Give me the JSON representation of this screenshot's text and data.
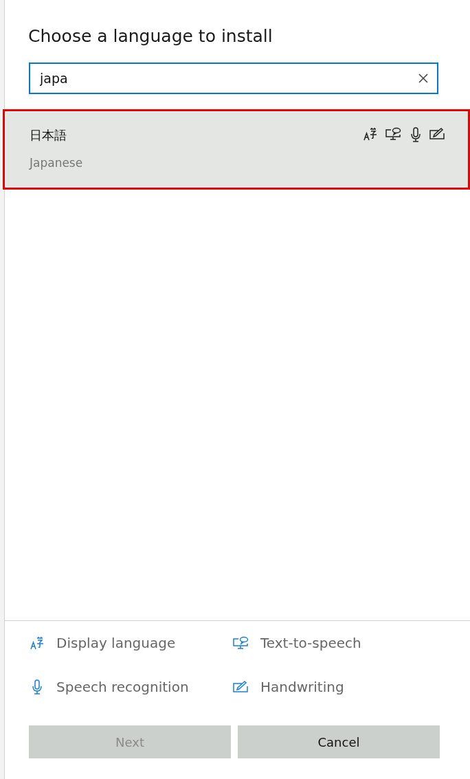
{
  "dialog": {
    "title": "Choose a language to install",
    "search": {
      "value": "japa"
    },
    "results": [
      {
        "native_name": "日本語",
        "name": "Japanese",
        "selected": true,
        "highlighted": true,
        "features": [
          {
            "kind": "display"
          },
          {
            "kind": "tts"
          },
          {
            "kind": "speech"
          },
          {
            "kind": "handwriting"
          }
        ]
      }
    ],
    "legend": [
      {
        "kind": "display",
        "label": "Display language"
      },
      {
        "kind": "tts",
        "label": "Text-to-speech"
      },
      {
        "kind": "speech",
        "label": "Speech recognition"
      },
      {
        "kind": "handwriting",
        "label": "Handwriting"
      }
    ],
    "buttons": [
      {
        "label": "Next",
        "disabled": true
      },
      {
        "label": "Cancel",
        "disabled": false
      }
    ]
  }
}
